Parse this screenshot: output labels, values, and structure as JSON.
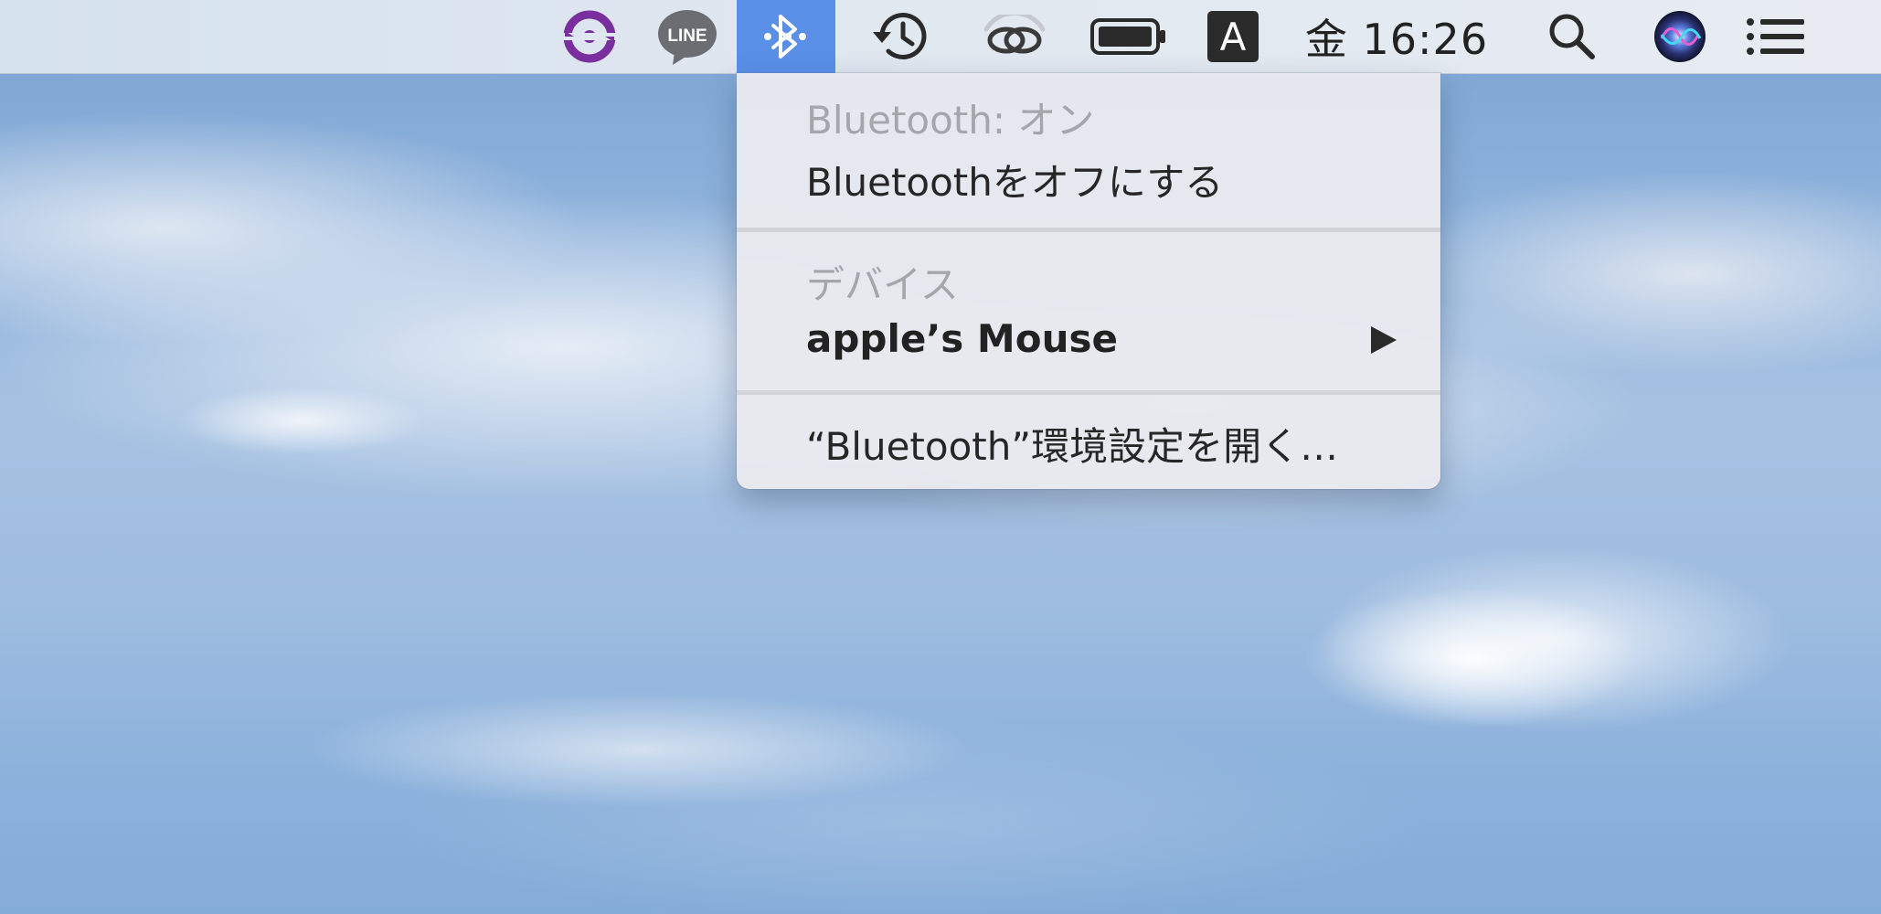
{
  "menubar": {
    "clock": "金 16:26",
    "line_label": "LINE",
    "input_source": "A",
    "active_color": "#5a8fe8",
    "icons": [
      "sync-icon",
      "line-icon",
      "bluetooth-icon",
      "time-machine-icon",
      "link-icon",
      "battery-icon",
      "input-source-icon",
      "search-icon",
      "siri-icon",
      "notification-center-icon"
    ]
  },
  "bluetooth_menu": {
    "status": "Bluetooth: オン",
    "turn_off": "Bluetoothをオフにする",
    "devices_header": "デバイス",
    "device": "apple’s Mouse",
    "open_prefs": "“Bluetooth”環境設定を開く…"
  }
}
